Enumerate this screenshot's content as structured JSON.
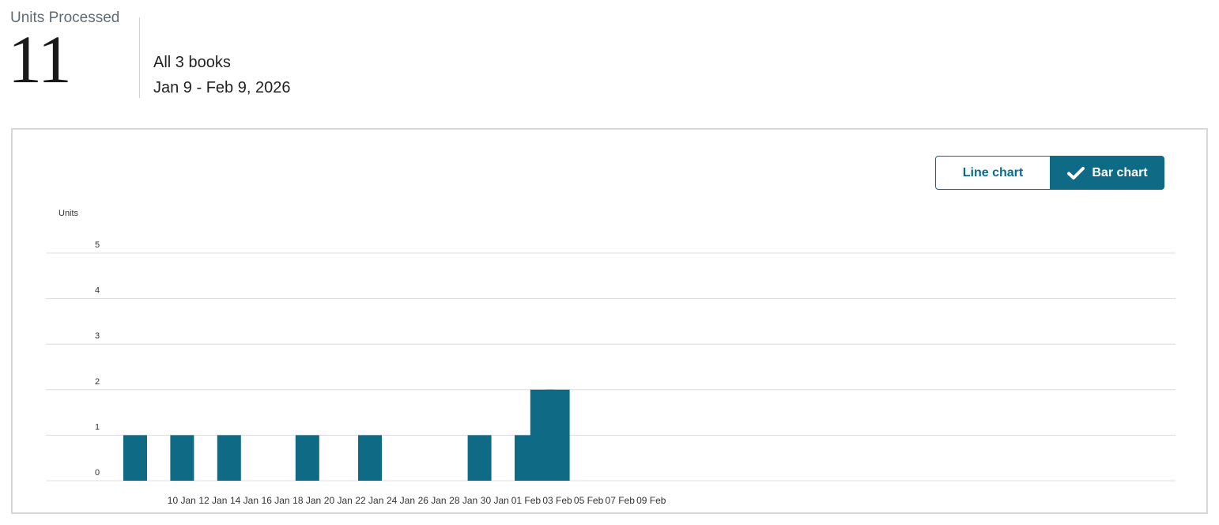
{
  "summary": {
    "label": "Units Processed",
    "value": "11",
    "scope": "All 3 books",
    "date_range": "Jan 9 - Feb 9, 2026"
  },
  "toggle": {
    "line_label": "Line chart",
    "bar_label": "Bar chart",
    "selected": "bar",
    "accent_color": "#0f6b85"
  },
  "colors": {
    "bar": "#0f6b85",
    "grid": "#dcdcdc",
    "axis_text": "#333333"
  },
  "chart_data": {
    "type": "bar",
    "ylabel": "Units",
    "xlabel": "",
    "ylim": [
      0,
      5
    ],
    "yticks": [
      0,
      1,
      2,
      3,
      4,
      5
    ],
    "grid": true,
    "x_tick_labels": [
      "10 Jan",
      "12 Jan",
      "14 Jan",
      "16 Jan",
      "18 Jan",
      "20 Jan",
      "22 Jan",
      "24 Jan",
      "26 Jan",
      "28 Jan",
      "30 Jan",
      "01 Feb",
      "03 Feb",
      "05 Feb",
      "07 Feb",
      "09 Feb"
    ],
    "categories": [
      "09 Jan",
      "12 Jan",
      "15 Jan",
      "20 Jan",
      "24 Jan",
      "31 Jan",
      "03 Feb",
      "04 Feb",
      "05 Feb"
    ],
    "values": [
      1,
      1,
      1,
      1,
      1,
      1,
      1,
      2,
      2
    ]
  }
}
